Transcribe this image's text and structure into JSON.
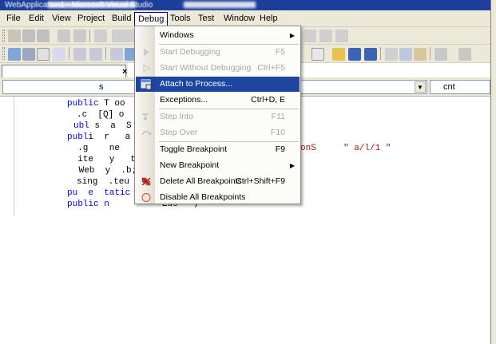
{
  "window": {
    "title": "WebApplication1 - Microsoft Visual Studio"
  },
  "menubar": {
    "items": [
      "File",
      "Edit",
      "View",
      "Project",
      "Build",
      "Debug",
      "Tools",
      "Test",
      "Window",
      "Help"
    ],
    "open_item": "Debug"
  },
  "editor": {
    "tab_close": "×",
    "nav_left": "s",
    "nav_right": "cnt",
    "code_lines": [
      {
        "kw": "public",
        "rest": " T oo"
      },
      {
        "kw": "",
        "rest": ".c  [Q] o"
      },
      {
        "kw": "ubl",
        "rest": " s  a  S"
      },
      {
        "kw": "publ",
        "rest": "i  r   a"
      },
      {
        "kw": "",
        "rest": "  .g    ne",
        "tail": "onS",
        "tail2": "\" a/l/1 \""
      },
      {
        "kw": "",
        "rest": "  ite   y   t"
      },
      {
        "kw": "",
        "rest": " Web  y  .b;"
      },
      {
        "kw": "",
        "rest": "sing  .teu"
      },
      {
        "kw": "pu  e  tatic",
        "rest": ""
      },
      {
        "kw": "public n",
        "rest": "          Eus = ;"
      }
    ]
  },
  "debug_menu": {
    "items": [
      {
        "label": "Windows",
        "shortcut": "",
        "submenu": true,
        "disabled": false,
        "icon": ""
      },
      {
        "label": "Start Debugging",
        "shortcut": "F5",
        "submenu": false,
        "disabled": true,
        "icon": "play-icon"
      },
      {
        "label": "Start Without Debugging",
        "shortcut": "Ctrl+F5",
        "submenu": false,
        "disabled": true,
        "icon": "play-outline-icon"
      },
      {
        "label": "Attach to Process...",
        "shortcut": "",
        "submenu": false,
        "disabled": false,
        "highlighted": true,
        "icon": "attach-process-icon"
      },
      {
        "label": "Exceptions...",
        "shortcut": "Ctrl+D, E",
        "submenu": false,
        "disabled": false,
        "icon": ""
      },
      {
        "label": "Step Into",
        "shortcut": "F11",
        "submenu": false,
        "disabled": true,
        "icon": "step-into-icon"
      },
      {
        "label": "Step Over",
        "shortcut": "F10",
        "submenu": false,
        "disabled": true,
        "icon": "step-over-icon"
      },
      {
        "label": "Toggle Breakpoint",
        "shortcut": "F9",
        "submenu": false,
        "disabled": false,
        "icon": ""
      },
      {
        "label": "New Breakpoint",
        "shortcut": "",
        "submenu": true,
        "disabled": false,
        "icon": ""
      },
      {
        "label": "Delete All Breakpoints",
        "shortcut": "Ctrl+Shift+F9",
        "submenu": false,
        "disabled": false,
        "icon": "delete-breakpoints-icon"
      },
      {
        "label": "Disable All Breakpoints",
        "shortcut": "",
        "submenu": false,
        "disabled": false,
        "icon": "disable-breakpoints-icon"
      }
    ]
  },
  "colors": {
    "menu_highlight": "#1c46a0",
    "disabled_text": "#a7a6aa",
    "keyword_blue": "#0000ff",
    "titlebar": "#1b3f9a"
  }
}
